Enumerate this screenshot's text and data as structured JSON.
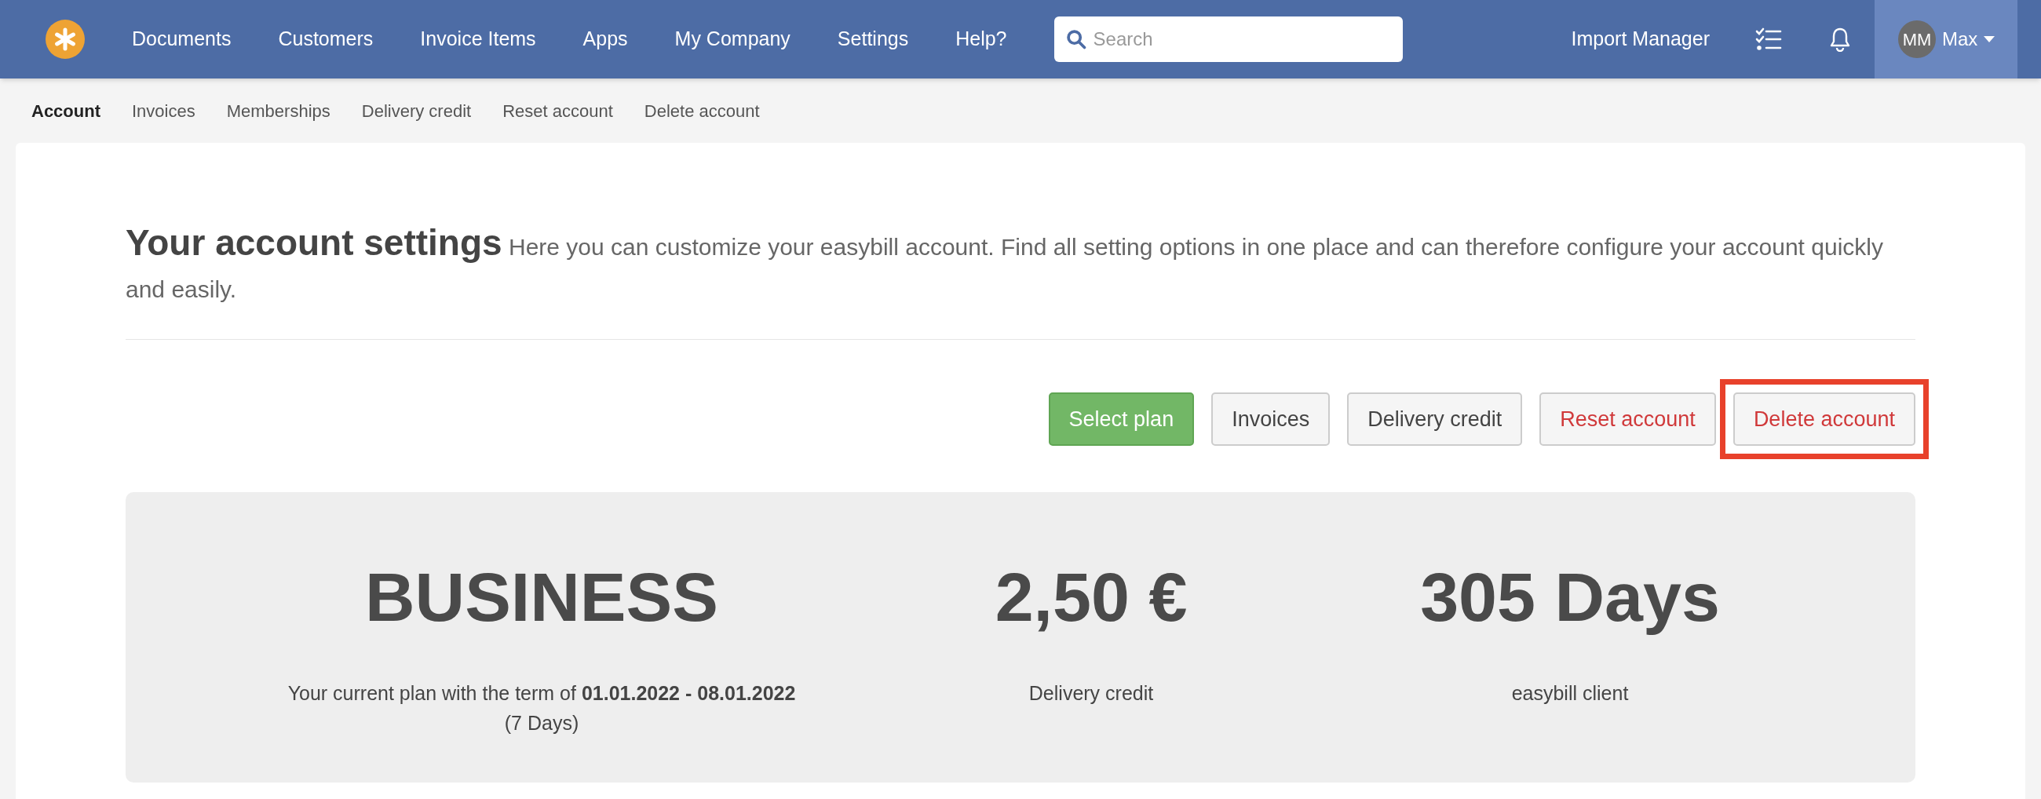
{
  "nav": {
    "items": [
      {
        "label": "Documents"
      },
      {
        "label": "Customers"
      },
      {
        "label": "Invoice Items"
      },
      {
        "label": "Apps"
      },
      {
        "label": "My Company"
      },
      {
        "label": "Settings"
      },
      {
        "label": "Help?"
      }
    ],
    "search": {
      "placeholder": "Search"
    },
    "import_manager": "Import Manager",
    "user": {
      "initials": "MM",
      "name": "Max"
    }
  },
  "subnav": [
    {
      "label": "Account",
      "selected": true
    },
    {
      "label": "Invoices",
      "selected": false
    },
    {
      "label": "Memberships",
      "selected": false
    },
    {
      "label": "Delivery credit",
      "selected": false
    },
    {
      "label": "Reset account",
      "selected": false
    },
    {
      "label": "Delete account",
      "selected": false
    }
  ],
  "heading": {
    "title": "Your account settings",
    "text": "Here you can customize your easybill account. Find all setting options in one place and can therefore configure your account quickly and easily."
  },
  "buttons": [
    {
      "label": "Select plan",
      "kind": "success",
      "highlighted": false
    },
    {
      "label": "Invoices",
      "kind": "default",
      "highlighted": false
    },
    {
      "label": "Delivery credit",
      "kind": "default",
      "highlighted": false
    },
    {
      "label": "Reset account",
      "kind": "danger",
      "highlighted": false
    },
    {
      "label": "Delete account",
      "kind": "danger",
      "highlighted": true
    }
  ],
  "stats": [
    {
      "value": "BUSINESS",
      "caption": "Your current plan with the term of **01.01.2022 - 08.01.2022**",
      "note": "(7 Days)"
    },
    {
      "value": "2,50 €",
      "caption": "Delivery credit"
    },
    {
      "value": "305 Days",
      "caption": "easybill client"
    }
  ]
}
